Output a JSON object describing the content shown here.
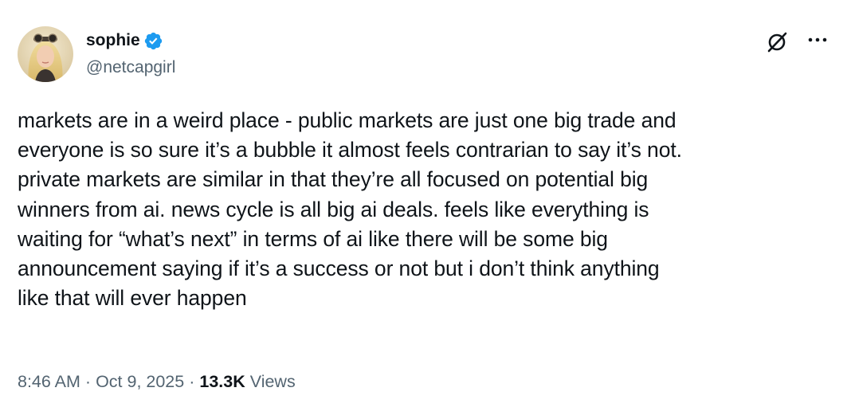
{
  "author": {
    "display_name": "sophie",
    "handle": "@netcapgirl",
    "verified": true,
    "verified_color": "#1d9bf0"
  },
  "tweet": {
    "lines": [
      "markets are in a weird place - public markets are just one big trade and",
      "everyone is so sure it’s a bubble it almost feels contrarian to say it’s not.",
      "private markets are similar in that they’re all focused on potential big",
      "winners from ai. news cycle is all big ai deals. feels like everything is",
      "waiting for “what’s next” in terms of ai like there will be some big",
      "announcement saying if it’s a success or not but i don’t think anything",
      "like that will ever happen"
    ]
  },
  "meta": {
    "time": "8:46 AM",
    "separator": "·",
    "date": "Oct 9, 2025",
    "views_count": "13.3K",
    "views_label": "Views"
  },
  "icons": {
    "grok": "grok-icon",
    "more": "more-options-icon",
    "verified": "verified-badge-icon"
  },
  "colors": {
    "text_primary": "#0f1419",
    "text_secondary": "#536471",
    "accent": "#1d9bf0"
  }
}
